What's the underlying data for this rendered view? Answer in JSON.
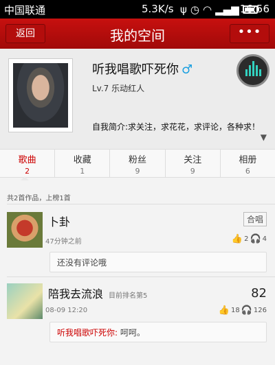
{
  "status_bar": {
    "carrier": "中国联通",
    "speed": "5.3K/s",
    "time": "16:56"
  },
  "header": {
    "back_label": "返回",
    "title": "我的空间",
    "more_label": "•••"
  },
  "profile": {
    "username": "听我唱歌吓死你",
    "gender_symbol": "♂",
    "level": "Lv.7 乐动红人",
    "bio": "自我简介:求关注，求花花，求评论，各种求！"
  },
  "tabs": [
    {
      "label": "歌曲",
      "count": "2"
    },
    {
      "label": "收藏",
      "count": "1"
    },
    {
      "label": "粉丝",
      "count": "9"
    },
    {
      "label": "关注",
      "count": "9"
    },
    {
      "label": "相册",
      "count": "6"
    }
  ],
  "summary": "共2首作品，上榜1首",
  "songs": [
    {
      "title": "卜卦",
      "badge": "合唱",
      "time": "47分钟之前",
      "likes": "2",
      "listens": "4",
      "comment": "还没有评论哦"
    },
    {
      "title": "陪我去流浪",
      "rank": "目前排名第5",
      "score": "82",
      "time": "08-09 12:20",
      "likes": "18",
      "listens": "126",
      "comment_user": "听我唱歌吓死你:",
      "comment_text": " 呵呵。"
    }
  ],
  "icons": {
    "gender": "male-icon",
    "music": "equalizer-icon",
    "like": "thumbs-up-icon",
    "listen": "headphones-icon"
  },
  "colors": {
    "brand_red": "#b30d0c",
    "gender_blue": "#1a9fe0",
    "equalizer_teal": "#32d2c0"
  }
}
